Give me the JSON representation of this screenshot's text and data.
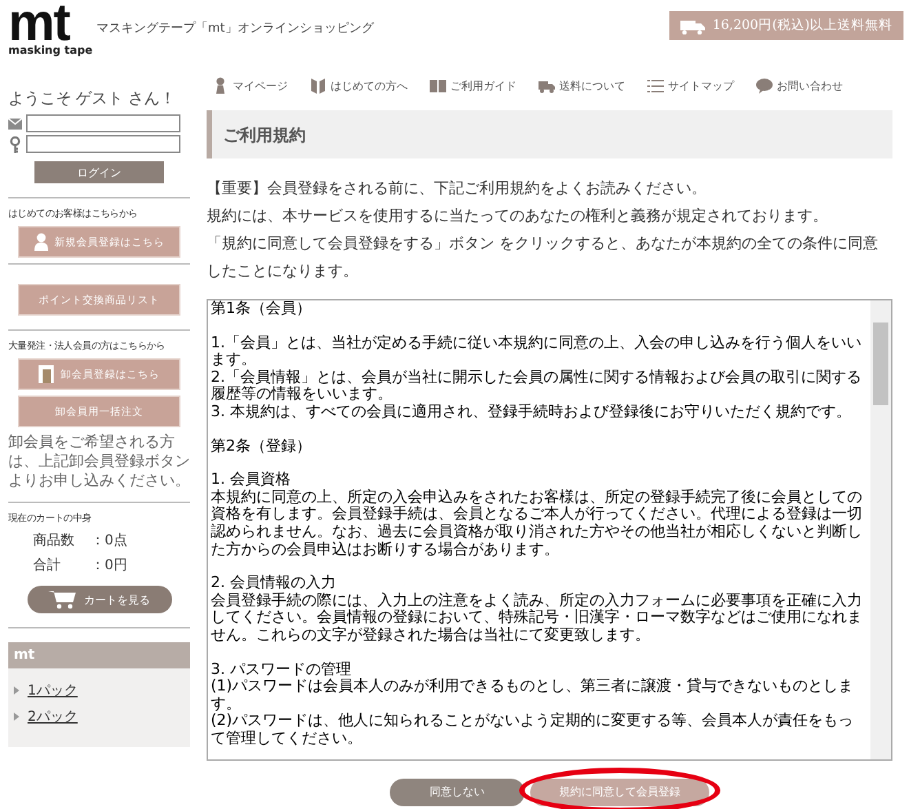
{
  "header": {
    "logo": "mt",
    "logo_sub": "masking tape",
    "tagline": "マスキングテープ「mt」オンラインショッピング",
    "shipping_banner": "16,200円(税込)以上送料無料"
  },
  "nav": [
    {
      "label": "マイページ"
    },
    {
      "label": "はじめての方へ"
    },
    {
      "label": "ご利用ガイド"
    },
    {
      "label": "送料について"
    },
    {
      "label": "サイトマップ"
    },
    {
      "label": "お問い合わせ"
    }
  ],
  "sidebar": {
    "welcome": "ようこそ ゲスト さん！",
    "login_button": "ログイン",
    "first_time_label": "はじめてのお客様はこちらから",
    "register_button": "新規会員登録はこちら",
    "points_button": "ポイント交換商品リスト",
    "wholesale_label": "大量発注・法人会員の方はこちらから",
    "wholesale_register_button": "卸会員登録はこちら",
    "wholesale_order_button": "卸会員用一括注文",
    "wholesale_note": "卸会員をご希望される方は、上記卸会員登録ボタンよりお申し込みください。",
    "cart_label": "現在のカートの中身",
    "cart_count_label": "商品数",
    "cart_count": "：0点",
    "cart_total_label": "合計",
    "cart_total": "：0円",
    "cart_button": "カートを見る",
    "category_title": "mt",
    "categories": [
      "1パック",
      "2パック"
    ]
  },
  "page_title": "ご利用規約",
  "intro": [
    "【重要】会員登録をされる前に、下記ご利用規約をよくお読みください。",
    "規約には、本サービスを使用するに当たってのあなたの権利と義務が規定されております。",
    "「規約に同意して会員登録をする」ボタン をクリックすると、あなたが本規約の全ての条件に同意したことになります。"
  ],
  "terms": [
    [
      "第1条（会員）"
    ],
    [
      "1.「会員」とは、当社が定める手続に従い本規約に同意の上、入会の申し込みを行う個人をいいます。",
      "2.「会員情報」とは、会員が当社に開示した会員の属性に関する情報および会員の取引に関する履歴等の情報をいいます。",
      "3. 本規約は、すべての会員に適用され、登録手続時および登録後にお守りいただく規約です。"
    ],
    [
      "第2条（登録）"
    ],
    [
      "1. 会員資格",
      "本規約に同意の上、所定の入会申込みをされたお客様は、所定の登録手続完了後に会員としての資格を有します。会員登録手続は、会員となるご本人が行ってください。代理による登録は一切認められません。なお、過去に会員資格が取り消された方やその他当社が相応しくないと判断した方からの会員申込はお断りする場合があります。"
    ],
    [
      "2. 会員情報の入力",
      "会員登録手続の際には、入力上の注意をよく読み、所定の入力フォームに必要事項を正確に入力してください。会員情報の登録において、特殊記号・旧漢字・ローマ数字などはご使用になれません。これらの文字が登録された場合は当社にて変更致します。"
    ],
    [
      "3. パスワードの管理",
      "(1)パスワードは会員本人のみが利用できるものとし、第三者に譲渡・貸与できないものとします。",
      "(2)パスワードは、他人に知られることがないよう定期的に変更する等、会員本人が責任をもって管理してください。"
    ]
  ],
  "buttons": [
    {
      "label": "同意しない",
      "kind": "decline",
      "highlighted": false
    },
    {
      "label": "規約に同意して会員登録",
      "kind": "agree",
      "highlighted": true
    }
  ]
}
